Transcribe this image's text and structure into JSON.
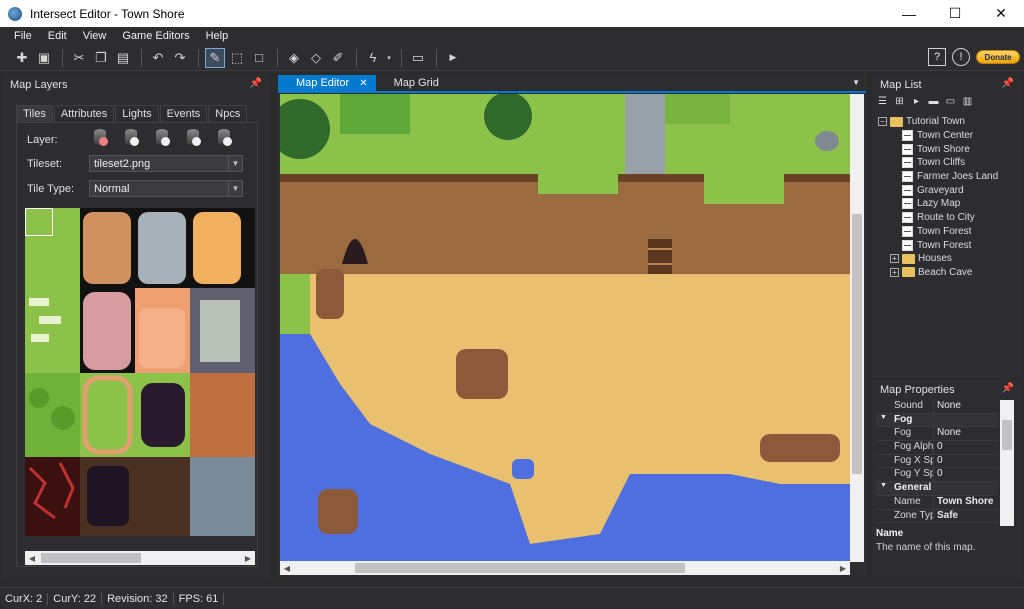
{
  "window": {
    "title": "Intersect Editor - Town Shore",
    "buttons": {
      "minimize": "—",
      "maximize": "☐",
      "close": "✕"
    }
  },
  "menu": [
    "File",
    "Edit",
    "View",
    "Game Editors",
    "Help"
  ],
  "toolbar": {
    "donate_label": "Donate",
    "help_label": "?",
    "alert_label": "!"
  },
  "map_layers": {
    "title": "Map Layers",
    "tabs": [
      "Tiles",
      "Attributes",
      "Lights",
      "Events",
      "Npcs"
    ],
    "layer_label": "Layer:",
    "tileset_label": "Tileset:",
    "tileset_value": "tileset2.png",
    "tile_type_label": "Tile Type:",
    "tile_type_value": "Normal"
  },
  "editor": {
    "tabs": [
      "Map Editor",
      "Map Grid"
    ],
    "active_tab": "Map Editor"
  },
  "map_list": {
    "title": "Map List",
    "root": "Tutorial Town",
    "maps": [
      "Town Center",
      "Town Shore",
      "Town Cliffs",
      "Farmer Joes Land",
      "Graveyard",
      "Lazy Map",
      "Route to City",
      "Town Forest",
      "Town Forest"
    ],
    "folders": [
      "Houses",
      "Beach Cave"
    ]
  },
  "map_properties": {
    "title": "Map Properties",
    "rows": [
      {
        "type": "prop",
        "key": "Sound",
        "value": "None"
      },
      {
        "type": "cat",
        "key": "Fog"
      },
      {
        "type": "prop",
        "key": "Fog",
        "value": "None"
      },
      {
        "type": "prop",
        "key": "Fog Alpha",
        "value": "0"
      },
      {
        "type": "prop",
        "key": "Fog X Speed",
        "value": "0"
      },
      {
        "type": "prop",
        "key": "Fog Y Speed",
        "value": "0"
      },
      {
        "type": "cat",
        "key": "General"
      },
      {
        "type": "prop",
        "key": "Name",
        "value": "Town Shore",
        "bold": true
      },
      {
        "type": "prop",
        "key": "Zone Type",
        "value": "Safe",
        "bold": true
      }
    ],
    "description_title": "Name",
    "description_text": "The name of this map."
  },
  "status": {
    "curx": "CurX: 2",
    "cury": "CurY: 22",
    "revision": "Revision: 32",
    "fps": "FPS: 61"
  },
  "colors": {
    "accent": "#007acc",
    "background": "#2d2d30",
    "grass": "#8cc24a",
    "water": "#4f6ee0",
    "sand": "#e8c070",
    "cliff": "#9a6a40"
  }
}
